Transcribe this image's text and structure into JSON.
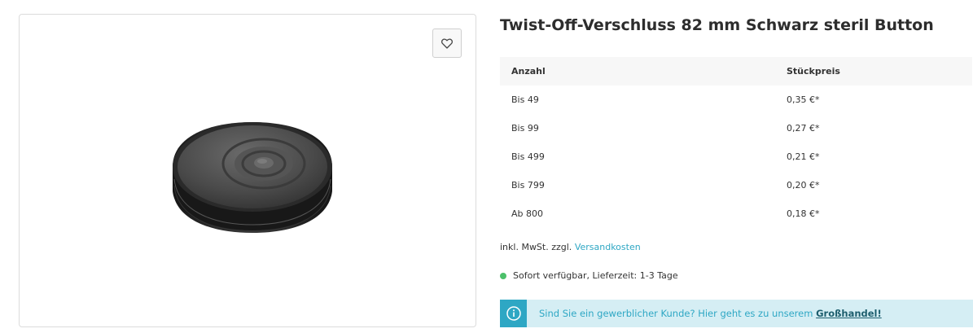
{
  "product": {
    "title": "Twist-Off-Verschluss 82 mm Schwarz steril Button",
    "image_alt": "Twist-Off-Deckel schwarz"
  },
  "gallery": {
    "wishlist_icon": "heart-icon"
  },
  "price_table": {
    "headers": [
      "Anzahl",
      "Stückpreis"
    ],
    "rows": [
      {
        "quantity": "Bis 49",
        "price": "0,35 €*"
      },
      {
        "quantity": "Bis 99",
        "price": "0,27 €*"
      },
      {
        "quantity": "Bis 499",
        "price": "0,21 €*"
      },
      {
        "quantity": "Bis 799",
        "price": "0,20 €*"
      },
      {
        "quantity": "Ab 800",
        "price": "0,18 €*"
      }
    ]
  },
  "tax": {
    "prefix": "inkl. MwSt. zzgl.",
    "link": "Versandkosten"
  },
  "delivery": {
    "text": "Sofort verfügbar, Lieferzeit: 1-3 Tage",
    "status_color": "#4cc06a"
  },
  "wholesale_alert": {
    "icon": "info-icon",
    "text": "Sind Sie ein gewerblicher Kunde? Hier geht es zu unserem",
    "link": "Großhandel!",
    "accent_color": "#2ea7c4"
  }
}
